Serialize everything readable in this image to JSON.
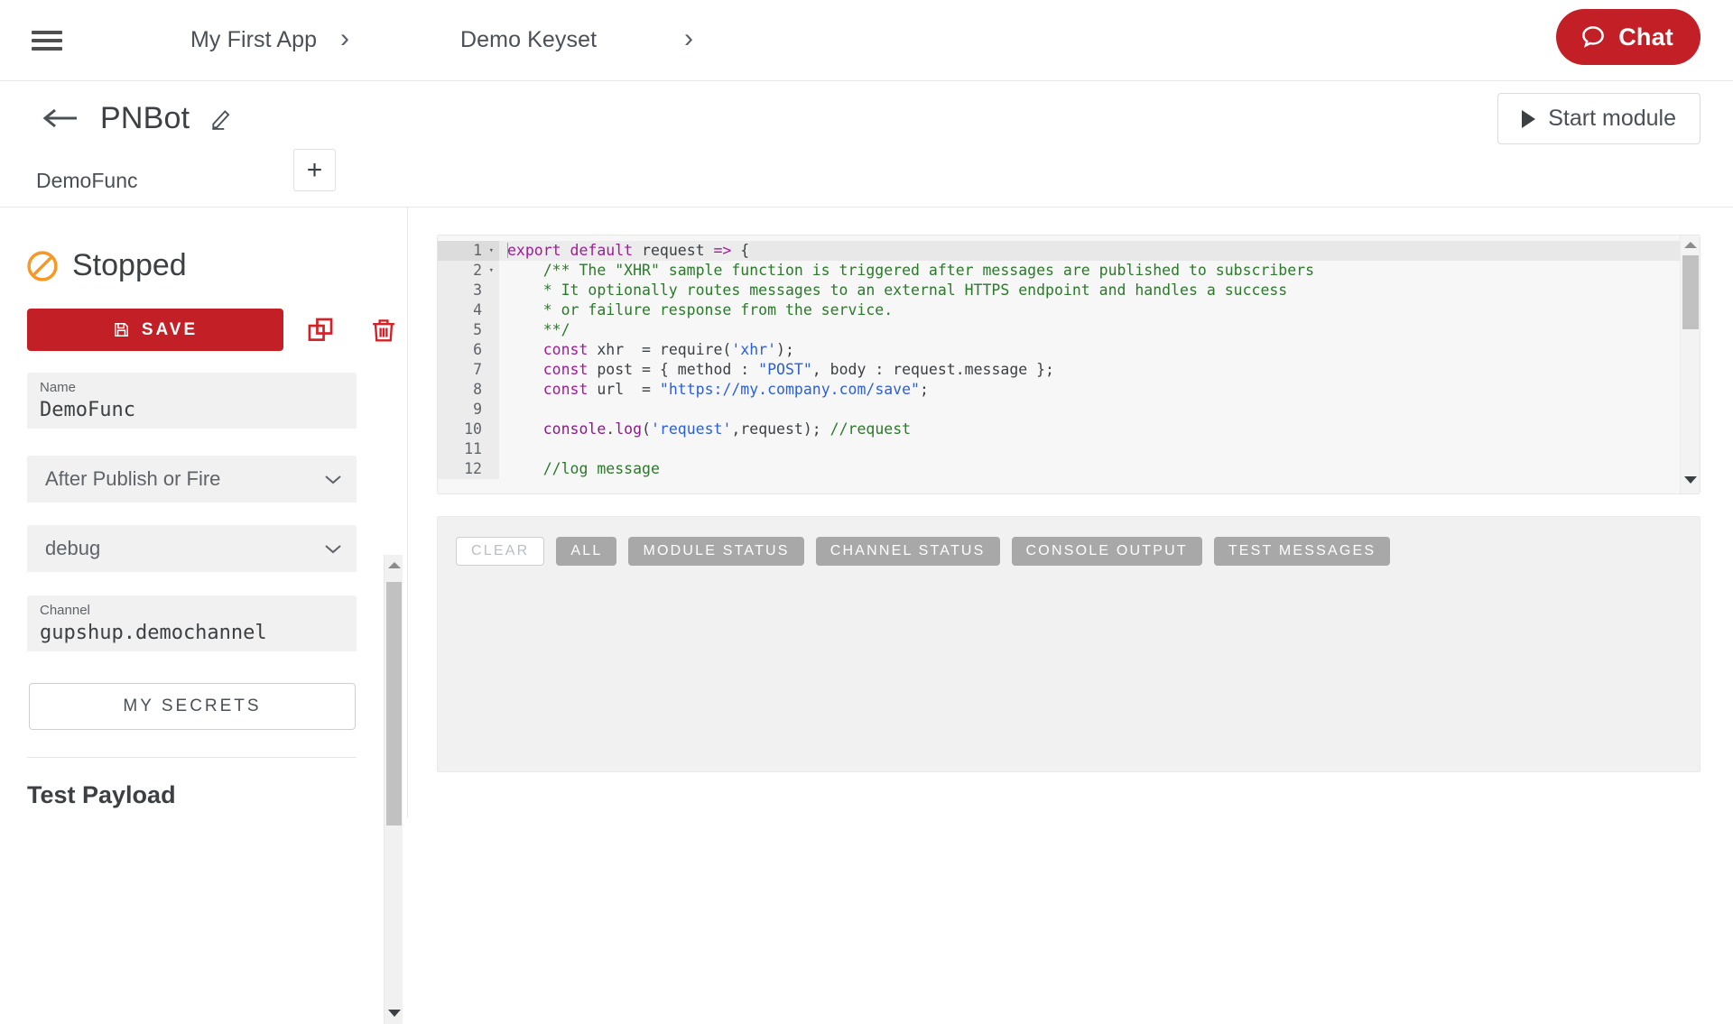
{
  "colors": {
    "brand_red": "#c22026",
    "status_orange": "#f79824",
    "filter_gray": "#a8a8a8",
    "text_dark": "#3c4043"
  },
  "topbar": {
    "menu_icon": "hamburger-menu-icon",
    "breadcrumbs": [
      {
        "label": "My First App"
      },
      {
        "label": "Demo Keyset"
      }
    ],
    "chevron": "›",
    "chat_button": {
      "label": "Chat",
      "icon": "chat-bubble-icon"
    }
  },
  "header": {
    "back_icon": "back-arrow-icon",
    "title": "PNBot",
    "edit_icon": "pencil-edit-icon",
    "start_module": {
      "label": "Start module",
      "icon": "play-triangle-icon"
    }
  },
  "tabs": {
    "items": [
      {
        "label": "DemoFunc",
        "active": true
      }
    ],
    "add_label": "+"
  },
  "sidebar": {
    "status": {
      "text": "Stopped",
      "icon": "stopped-circle-slash-icon",
      "color": "#f79824"
    },
    "save_button": {
      "label": "SAVE",
      "icon": "floppy-save-icon"
    },
    "copy_button": {
      "icon": "copy-duplicate-icon"
    },
    "delete_button": {
      "icon": "trash-delete-icon"
    },
    "fields": {
      "name": {
        "label": "Name",
        "value": "DemoFunc"
      },
      "trigger": {
        "value": "After Publish or Fire",
        "icon": "chevron-down-icon"
      },
      "log_level": {
        "value": "debug",
        "icon": "chevron-down-icon"
      },
      "channel": {
        "label": "Channel",
        "value": "gupshup.demochannel"
      }
    },
    "secrets_button": {
      "label": "MY SECRETS"
    },
    "payload_title": "Test Payload",
    "payload_value": ""
  },
  "editor": {
    "lines": [
      {
        "n": "1",
        "fold": true,
        "active": true
      },
      {
        "n": "2",
        "fold": true
      },
      {
        "n": "3"
      },
      {
        "n": "4"
      },
      {
        "n": "5"
      },
      {
        "n": "6"
      },
      {
        "n": "7"
      },
      {
        "n": "8"
      },
      {
        "n": "9"
      },
      {
        "n": "10"
      },
      {
        "n": "11"
      },
      {
        "n": "12"
      }
    ],
    "code_text": [
      "export default request => {",
      "    /** The \"XHR\" sample function is triggered after messages are published to subscribers",
      "    * It optionally routes messages to an external HTTPS endpoint and handles a success",
      "    * or failure response from the service.",
      "    **/",
      "    const xhr  = require('xhr');",
      "    const post = { method : \"POST\", body : request.message };",
      "    const url  = \"https://my.company.com/save\";",
      "",
      "    console.log('request',request); //request",
      "",
      "    //log message"
    ]
  },
  "console": {
    "filters": [
      {
        "label": "CLEAR",
        "style": "outline"
      },
      {
        "label": "ALL",
        "style": "filled"
      },
      {
        "label": "MODULE STATUS",
        "style": "filled"
      },
      {
        "label": "CHANNEL STATUS",
        "style": "filled"
      },
      {
        "label": "CONSOLE OUTPUT",
        "style": "filled"
      },
      {
        "label": "TEST MESSAGES",
        "style": "filled"
      }
    ],
    "output": ""
  }
}
